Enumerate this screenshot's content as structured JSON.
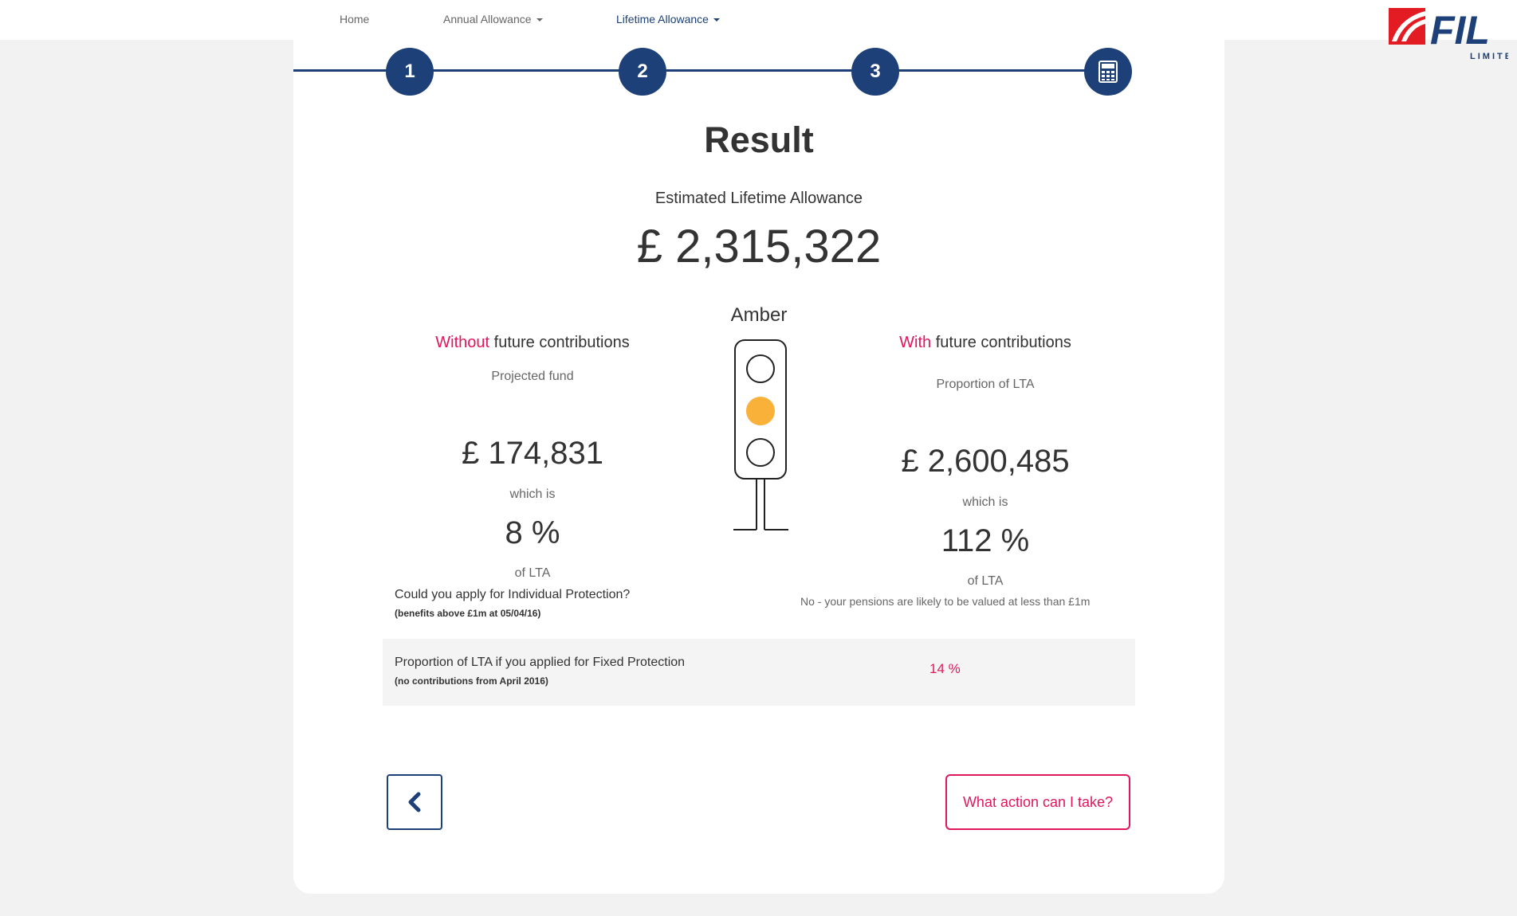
{
  "nav": {
    "home": "Home",
    "annual": "Annual Allowance",
    "lifetime": "Lifetime Allowance"
  },
  "logo": {
    "name": "FIL",
    "sub": "LIMITED",
    "icon": "fil-logo",
    "accent": "#e31b23",
    "brand": "#1c4077"
  },
  "steps": [
    "1",
    "2",
    "3"
  ],
  "calculator_icon": "calculator-icon",
  "result": {
    "title": "Result",
    "subtitle": "Estimated Lifetime Allowance",
    "amount": "£ 2,315,322",
    "status": "Amber",
    "status_color": "#f9b13a"
  },
  "without": {
    "head_highlight": "Without",
    "head_rest": " future contributions",
    "label": "Projected fund",
    "amount": "£ 174,831",
    "which_is": "which is",
    "percent": "8 %",
    "of_lta": "of LTA"
  },
  "with": {
    "head_highlight": "With",
    "head_rest": " future contributions",
    "label": "Proportion of LTA",
    "amount": "£ 2,600,485",
    "which_is": "which is",
    "percent": "112 %",
    "of_lta": "of LTA"
  },
  "individual": {
    "question": "Could you apply for Individual Protection?",
    "note": "(benefits above £1m at 05/04/16)",
    "answer": "No - your pensions are likely to be valued at less than £1m"
  },
  "fixed": {
    "question": "Proportion of LTA if you applied for Fixed Protection",
    "note": "(no contributions from April 2016)",
    "answer": "14 %"
  },
  "buttons": {
    "back_icon": "chevron-left-icon",
    "action": "What action can I take?"
  }
}
